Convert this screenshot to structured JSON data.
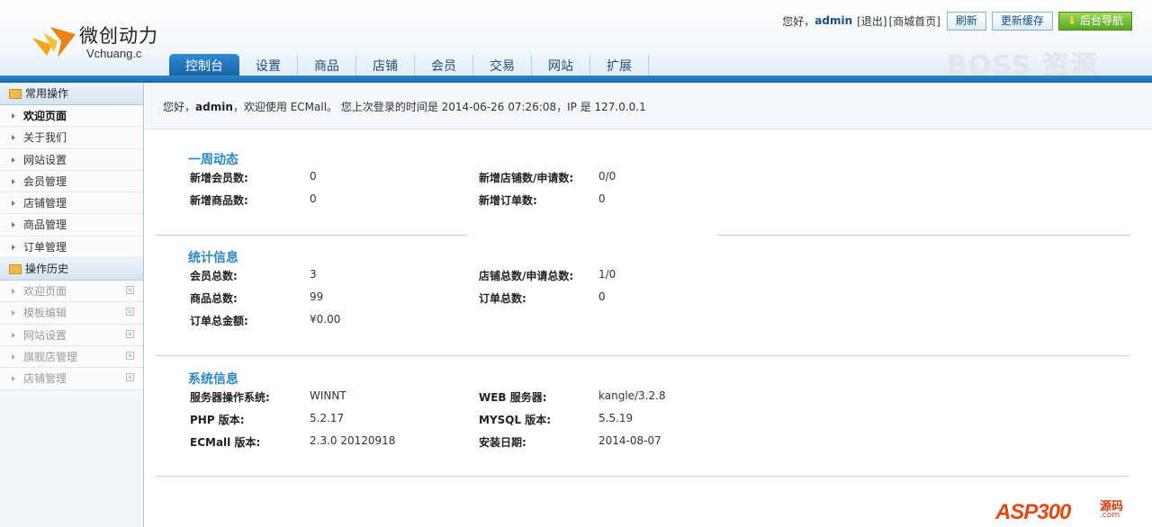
{
  "header": {
    "brand_name": "微创动力",
    "brand_sub": "Vchuang.c",
    "greeting": "您好，",
    "user": "admin",
    "logout": "[退出]",
    "store_home": "[商城首页]",
    "refresh_btn": "刷新",
    "update_cache_btn": "更新缓存",
    "admin_nav_btn": "后台导航",
    "watermark": "BOSS 资源"
  },
  "nav": {
    "tabs": [
      "控制台",
      "设置",
      "商品",
      "店铺",
      "会员",
      "交易",
      "网站",
      "扩展"
    ],
    "active": "控制台"
  },
  "sidebar": {
    "common_title": "常用操作",
    "common_items": [
      "欢迎页面",
      "关于我们",
      "网站设置",
      "会员管理",
      "店铺管理",
      "商品管理",
      "订单管理"
    ],
    "history_title": "操作历史",
    "history_items": [
      "欢迎页面",
      "模板编辑",
      "网站设置",
      "旗舰店管理",
      "店铺管理"
    ]
  },
  "welcome": {
    "prefix": "您好，",
    "user": "admin",
    "middle": "，欢迎使用 ECMall。 您上次登录的时间是 2014-06-26 07:26:08，IP 是 127.0.0.1"
  },
  "weekly": {
    "title": "一周动态",
    "rows": [
      {
        "l1": "新增会员数:",
        "v1": "0",
        "l2": "新增店铺数/申请数:",
        "v2": "0/0"
      },
      {
        "l1": "新增商品数:",
        "v1": "0",
        "l2": "新增订单数:",
        "v2": "0"
      }
    ]
  },
  "stats": {
    "title": "统计信息",
    "rows": [
      {
        "l1": "会员总数:",
        "v1": "3",
        "l2": "店铺总数/申请总数:",
        "v2": "1/0"
      },
      {
        "l1": "商品总数:",
        "v1": "99",
        "l2": "订单总数:",
        "v2": "0"
      },
      {
        "l1": "订单总金额:",
        "v1": "¥0.00",
        "l2": "",
        "v2": ""
      }
    ]
  },
  "sysinfo": {
    "title": "系统信息",
    "rows": [
      {
        "l1": "服务器操作系统:",
        "v1": "WINNT",
        "l2": "WEB 服务器:",
        "v2": "kangle/3.2.8"
      },
      {
        "l1": "PHP 版本:",
        "v1": "5.2.17",
        "l2": "MYSQL 版本:",
        "v2": "5.5.19"
      },
      {
        "l1": "ECMall 版本:",
        "v1": "2.3.0 20120918",
        "l2": "安装日期:",
        "v2": "2014-08-07"
      }
    ]
  },
  "footer_logo": {
    "text": "ASP300",
    "cn": "源码",
    "com": ".com"
  },
  "colors": {
    "accent_blue": "#1a6aac",
    "section_title": "#2b87c5",
    "green_button": "#58a625"
  },
  "icons": {
    "logo": "v-wing-logo",
    "folder": "folder-icon",
    "arrow": "triangle-right-icon",
    "close": "close-icon",
    "download": "down-arrow-icon"
  }
}
